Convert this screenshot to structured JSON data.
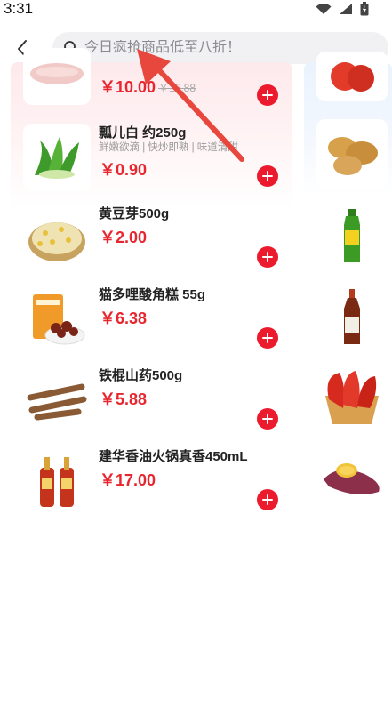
{
  "status_bar": {
    "time": "3:31"
  },
  "search": {
    "placeholder": "今日疯抢商品低至八折！",
    "value": ""
  },
  "products": [
    {
      "name": "",
      "desc": "",
      "price": "￥10.00",
      "orig_price": "￥15.88",
      "image": "pork-meat"
    },
    {
      "name": "瓢儿白 约250g",
      "desc": "鲜嫩欲滴 | 快炒即熟 | 味道清甜",
      "price": "￥0.90",
      "orig_price": "",
      "image": "bok-choy"
    },
    {
      "name": "黄豆芽500g",
      "desc": "",
      "price": "￥2.00",
      "orig_price": "",
      "image": "bean-sprouts"
    },
    {
      "name": "猫多哩酸角糕 55g",
      "desc": "",
      "price": "￥6.38",
      "orig_price": "",
      "image": "tamarind-candy"
    },
    {
      "name": "铁棍山药500g",
      "desc": "",
      "price": "￥5.88",
      "orig_price": "",
      "image": "yam"
    },
    {
      "name": "建华香油火锅真香450mL",
      "desc": "",
      "price": "￥17.00",
      "orig_price": "",
      "image": "sesame-oil"
    }
  ],
  "right_products": [
    {
      "image": "tomato"
    },
    {
      "image": "potato"
    },
    {
      "image": "oil-bottle"
    },
    {
      "image": "cooking-wine"
    },
    {
      "image": "red-pepper"
    },
    {
      "image": "sweet-potato"
    }
  ],
  "colors": {
    "accent": "#ec1a2d",
    "price": "#e8262f",
    "search_bg": "#f1f1f4"
  }
}
